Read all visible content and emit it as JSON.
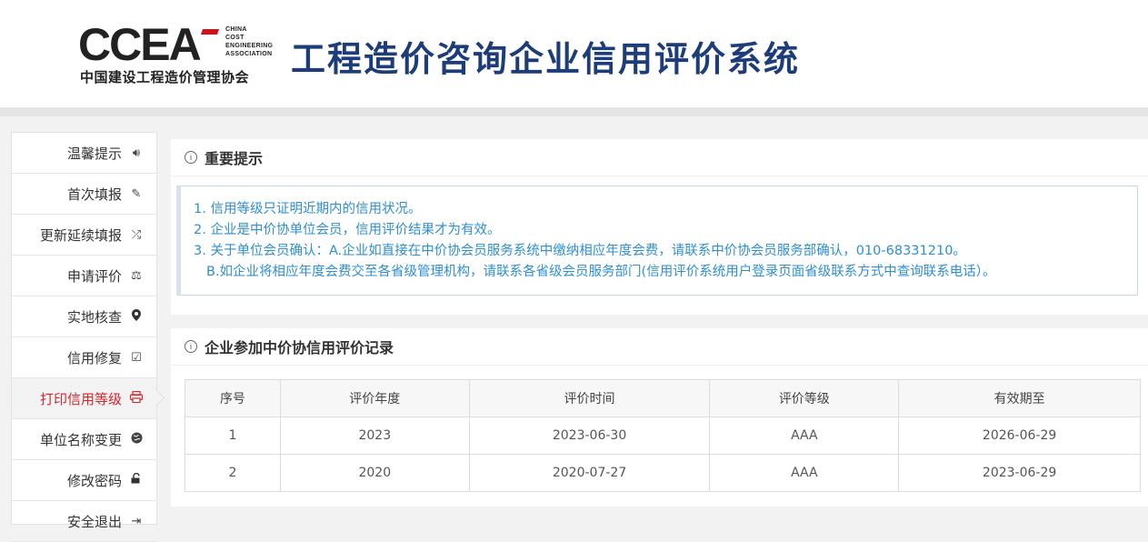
{
  "header": {
    "logo_abbr": "CCEA",
    "logo_sub": [
      "CHINA",
      "COST",
      "ENGINEERING",
      "ASSOCIATION"
    ],
    "logo_cn": "中国建设工程造价管理协会",
    "system_title": "工程造价咨询企业信用评价系统",
    "brand_color": "#1c3d7a",
    "accent_color": "#c9151e"
  },
  "sidebar": {
    "active_index": 6,
    "items": [
      {
        "label": "温馨提示",
        "icon": "volume-icon"
      },
      {
        "label": "首次填报",
        "icon": "edit-icon"
      },
      {
        "label": "更新延续填报",
        "icon": "shuffle-icon"
      },
      {
        "label": "申请评价",
        "icon": "scale-icon"
      },
      {
        "label": "实地核查",
        "icon": "map-marker-icon"
      },
      {
        "label": "信用修复",
        "icon": "check-square-icon"
      },
      {
        "label": "打印信用等级",
        "icon": "print-icon"
      },
      {
        "label": "单位名称变更",
        "icon": "globe-icon"
      },
      {
        "label": "修改密码",
        "icon": "unlock-icon"
      },
      {
        "label": "安全退出",
        "icon": "sign-out-icon"
      }
    ]
  },
  "notice": {
    "title": "重要提示",
    "lines": [
      "1. 信用等级只证明近期内的信用状况。",
      "2. 企业是中价协单位会员，信用评价结果才为有效。",
      "3. 关于单位会员确认：A.企业如直接在中价协会员服务系统中缴纳相应年度会费，请联系中价协会员服务部确认，010-68331210。",
      "B.如企业将相应年度会费交至各省级管理机构，请联系各省级会员服务部门(信用评价系统用户登录页面省级联系方式中查询联系电话）。"
    ]
  },
  "records": {
    "title": "企业参加中价协信用评价记录",
    "columns": [
      "序号",
      "评价年度",
      "评价时间",
      "评价等级",
      "有效期至"
    ],
    "rows": [
      [
        "1",
        "2023",
        "2023-06-30",
        "AAA",
        "2026-06-29"
      ],
      [
        "2",
        "2020",
        "2020-07-27",
        "AAA",
        "2023-06-29"
      ]
    ]
  }
}
